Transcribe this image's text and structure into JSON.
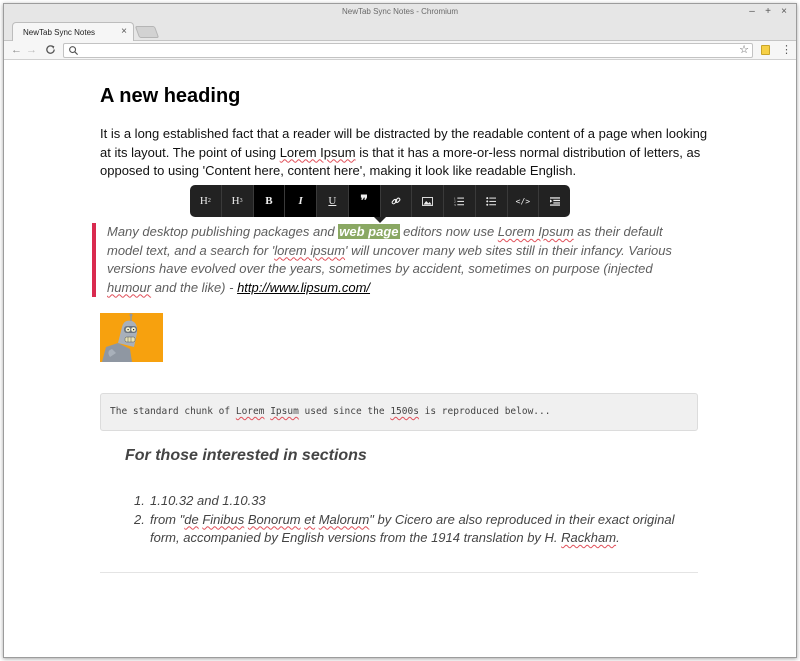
{
  "window": {
    "title": "NewTab Sync Notes - Chromium",
    "minimize": "–",
    "maximize": "+",
    "close": "×"
  },
  "tab": {
    "title": "NewTab Sync Notes",
    "close": "×"
  },
  "toolbar": {
    "back": "←",
    "forward": "→",
    "reload": "C",
    "url": "",
    "star": "☆",
    "menu": "⋮"
  },
  "document": {
    "heading": "A new heading",
    "paragraph": {
      "t1": "It is a long established fact that a reader will be distracted by the readable content of a page when looking at its layout. The point of using ",
      "s1": "Lorem Ipsum",
      "t2": " is that it has a more-or-less normal distribution of letters, as opposed to using 'Content here, content here', making it look like readable English."
    },
    "editor_toolbar": [
      {
        "name": "h2-button",
        "label": "H",
        "sup": "2"
      },
      {
        "name": "h3-button",
        "label": "H",
        "sup": "3"
      },
      {
        "name": "bold-button",
        "label": "B"
      },
      {
        "name": "italic-button",
        "label": "I"
      },
      {
        "name": "underline-button",
        "label": "U"
      },
      {
        "name": "quote-button",
        "label": "❞"
      },
      {
        "name": "link-button",
        "label": "link-icon"
      },
      {
        "name": "image-button",
        "label": "image-icon"
      },
      {
        "name": "ordered-list-button",
        "label": "ordered-list-icon"
      },
      {
        "name": "unordered-list-button",
        "label": "unordered-list-icon"
      },
      {
        "name": "code-button",
        "label": "</>"
      },
      {
        "name": "indent-button",
        "label": "indent-icon"
      }
    ],
    "quote": {
      "t1": "Many desktop publishing packages and ",
      "highlight": "web page",
      "t2": " editors now use ",
      "s1": "Lorem Ipsum",
      "t3": " as their default model text, and a search for '",
      "s2": "lorem ipsum",
      "t4": "' will uncover many web sites still in their infancy. Various versions have evolved over the years, sometimes by accident, sometimes on purpose (injected ",
      "s3": "humour",
      "t5": " and the like) - ",
      "link": "http://www.lipsum.com/"
    },
    "code": {
      "t1": "The standard chunk of ",
      "s1": "Lorem",
      "t2": " ",
      "s2": "Ipsum",
      "t3": " used since the ",
      "s3": "1500s",
      "t4": " is reproduced below..."
    },
    "subheading": "For those interested in sections",
    "list": {
      "n1": "1.",
      "item1": "1.10.32 and 1.10.33",
      "n2": "2.",
      "t1": "from \"",
      "s1": "de",
      "t2": " ",
      "s2": "Finibus",
      "t3": " ",
      "s3": "Bonorum",
      "t4": " ",
      "s4": "et",
      "t5": " ",
      "s5": "Malorum",
      "t6": "\" by Cicero are also reproduced in their exact original form, accompanied by English versions from the 1914 translation by H. ",
      "s6": "Rackham",
      "t7": "."
    }
  },
  "colors": {
    "quote_border": "#d92a4f",
    "highlight": "#8aa863",
    "toolbar_bg": "#222222",
    "image_bg": "#f7a10e"
  }
}
